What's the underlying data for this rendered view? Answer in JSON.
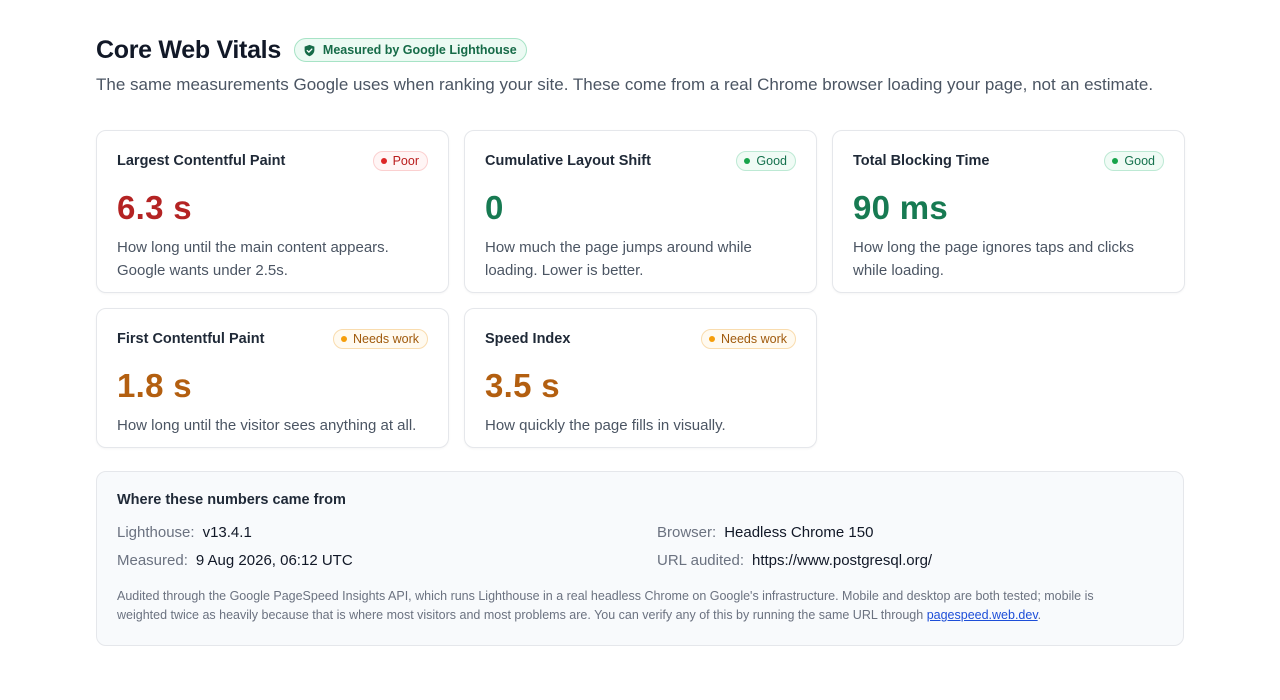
{
  "header": {
    "title": "Core Web Vitals",
    "badge": "Measured by Google Lighthouse",
    "subtitle": "The same measurements Google uses when ranking your site. These come from a real Chrome browser loading your page, not an estimate."
  },
  "metrics": [
    {
      "label": "Largest Contentful Paint",
      "status": "Poor",
      "value": "6.3 s",
      "desc": "How long until the main content appears. Google wants under 2.5s."
    },
    {
      "label": "Cumulative Layout Shift",
      "status": "Good",
      "value": "0",
      "desc": "How much the page jumps around while loading. Lower is better."
    },
    {
      "label": "Total Blocking Time",
      "status": "Good",
      "value": "90 ms",
      "desc": "How long the page ignores taps and clicks while loading."
    },
    {
      "label": "First Contentful Paint",
      "status": "Needs work",
      "value": "1.8 s",
      "desc": "How long until the visitor sees anything at all."
    },
    {
      "label": "Speed Index",
      "status": "Needs work",
      "value": "3.5 s",
      "desc": "How quickly the page fills in visually."
    }
  ],
  "source": {
    "title": "Where these numbers came from",
    "lighthouse_key": "Lighthouse:",
    "lighthouse_val": "v13.4.1",
    "measured_key": "Measured:",
    "measured_val": "9 Aug 2026, 06:12 UTC",
    "browser_key": "Browser:",
    "browser_val": "Headless Chrome 150",
    "url_key": "URL audited:",
    "url_val": "https://www.postgresql.org/",
    "note": "Audited through the Google PageSpeed Insights API, which runs Lighthouse in a real headless Chrome on Google's infrastructure. Mobile and desktop are both tested; mobile is weighted twice as heavily because that is where most visitors and most problems are. You can verify any of this by running the same URL through ",
    "link": "pagespeed.web.dev",
    "note_end": "."
  },
  "colors": {
    "poor": "#b42323",
    "good": "#177a52",
    "needs_work": "#b35f10"
  },
  "icons": {
    "badge": "check-shield-icon"
  }
}
